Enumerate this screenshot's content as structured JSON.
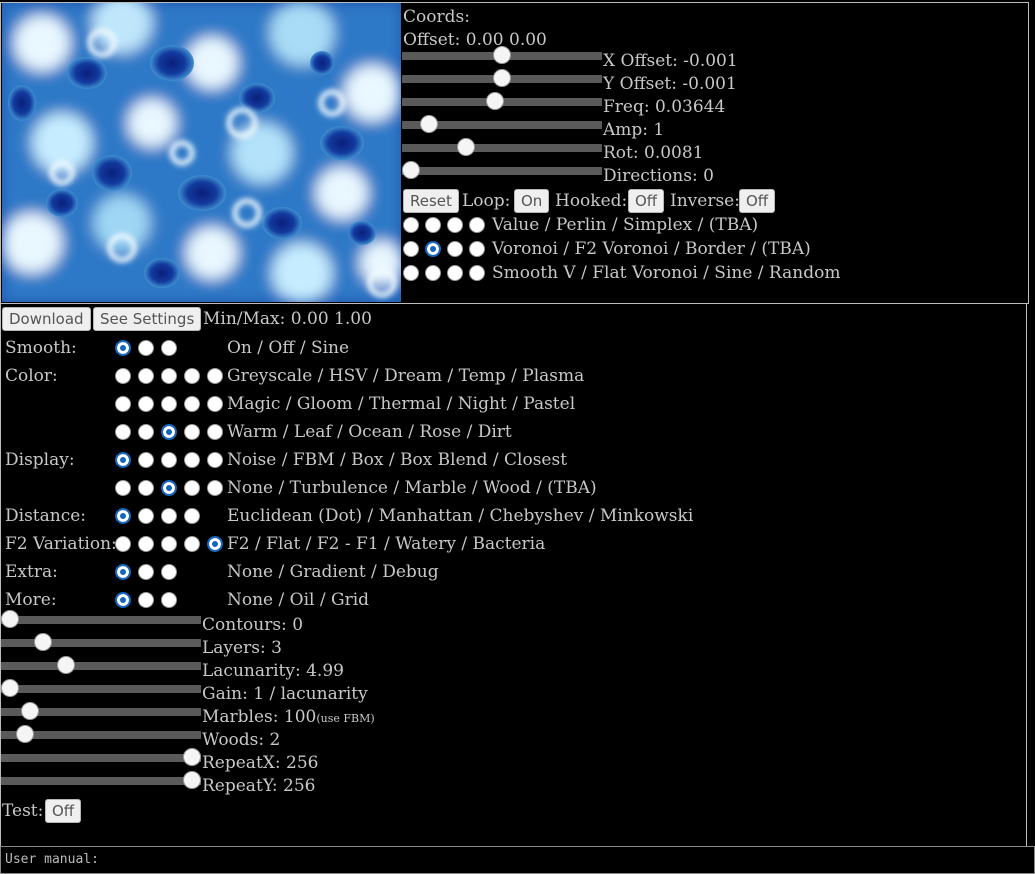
{
  "coords": {
    "title": "Coords:",
    "offset": "Offset: 0.00 0.00",
    "sliders": [
      {
        "label": "X Offset: -0.001",
        "value": 0.5
      },
      {
        "label": "Y Offset: -0.001",
        "value": 0.5
      },
      {
        "label": "Freq: 0.03644",
        "value": 0.46
      },
      {
        "label": "Amp: 1",
        "value": 0.1
      },
      {
        "label": "Rot: 0.0081",
        "value": 0.3
      },
      {
        "label": "Directions: 0",
        "value": 0.0
      }
    ],
    "buttons": {
      "reset": "Reset",
      "loop_label": "Loop:",
      "loop": "On",
      "hooked_label": "Hooked:",
      "hooked": "Off",
      "inverse_label": "Inverse:",
      "inverse": "Off"
    },
    "noise_rows": [
      {
        "label": "Value / Perlin / Simplex / (TBA)",
        "checked": -1
      },
      {
        "label": "Voronoi / F2 Voronoi / Border / (TBA)",
        "checked": 1
      },
      {
        "label": "Smooth V / Flat Voronoi / Sine / Random",
        "checked": -1
      }
    ]
  },
  "settings": {
    "download": "Download",
    "see_settings": "See Settings",
    "minmax": "Min/Max: 0.00 1.00",
    "rows": [
      {
        "name": "Smooth:",
        "count": 3,
        "checked": 0,
        "label": "On / Off / Sine"
      },
      {
        "name": "Color:",
        "count": 5,
        "checked": -1,
        "label": "Greyscale / HSV / Dream / Temp / Plasma"
      },
      {
        "name": "",
        "count": 5,
        "checked": -1,
        "label": "Magic / Gloom / Thermal / Night / Pastel"
      },
      {
        "name": "",
        "count": 5,
        "checked": 2,
        "label": "Warm / Leaf / Ocean / Rose / Dirt"
      },
      {
        "name": "Display:",
        "count": 5,
        "checked": 0,
        "label": "Noise / FBM / Box / Box Blend / Closest"
      },
      {
        "name": "",
        "count": 5,
        "checked": 2,
        "label": "None / Turbulence / Marble / Wood / (TBA)"
      },
      {
        "name": "Distance:",
        "count": 4,
        "checked": 0,
        "label": "Euclidean (Dot) / Manhattan / Chebyshev / Minkowski"
      },
      {
        "name": "F2 Variation:",
        "count": 5,
        "checked": 4,
        "label": "F2 / Flat / F2 - F1 / Watery / Bacteria"
      },
      {
        "name": "Extra:",
        "count": 3,
        "checked": 0,
        "label": "None / Gradient / Debug"
      },
      {
        "name": "More:",
        "count": 3,
        "checked": 0,
        "label": "None / Oil / Grid"
      }
    ],
    "sliders": [
      {
        "label": "Contours: 0",
        "value": 0.0
      },
      {
        "label": "Layers: 3",
        "value": 0.18
      },
      {
        "label": "Lacunarity: 4.99",
        "value": 0.31
      },
      {
        "label": "Gain: 1 / lacunarity",
        "value": 0.0
      },
      {
        "label": "Marbles: 100",
        "note": "(use FBM)",
        "value": 0.11
      },
      {
        "label": "Woods: 2",
        "value": 0.08
      },
      {
        "label": "RepeatX: 256",
        "value": 1.0
      },
      {
        "label": "RepeatY: 256",
        "value": 1.0
      }
    ],
    "test_label": "Test:",
    "test": "Off"
  },
  "manual": "User manual:",
  "colors": {
    "accent": "#1565c0",
    "bg": "#000000",
    "text": "#c8c8c8",
    "noise_dark": "#0b2a8a",
    "noise_light": "#e8f6ff"
  }
}
